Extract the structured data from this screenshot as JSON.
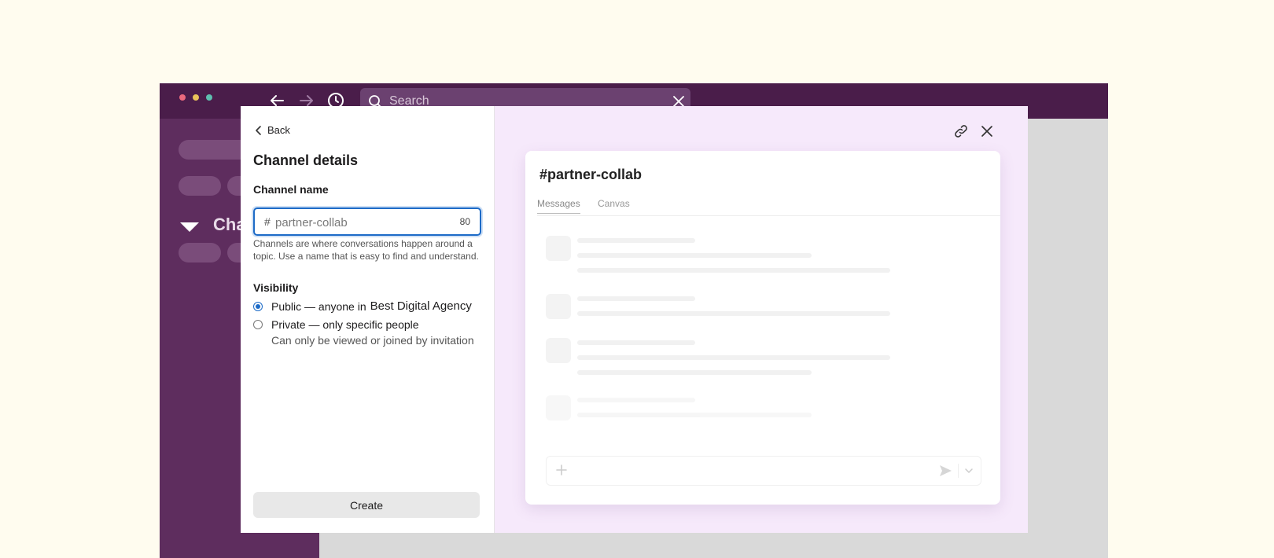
{
  "background_color": "#fffcef",
  "app": {
    "titlebar_color": "#4a1d4a",
    "sidebar_color": "#5e2d5e",
    "search": {
      "placeholder": "Search"
    },
    "sidebar": {
      "section_title": "Cha"
    }
  },
  "modal": {
    "back_label": "Back",
    "title": "Channel details",
    "channel_name": {
      "label": "Channel name",
      "prefix": "#",
      "value": "partner-collab",
      "char_count": "80",
      "help": "Channels are where conversations happen around a topic. Use a name that is easy to find and understand."
    },
    "visibility": {
      "label": "Visibility",
      "public_label": "Public — anyone in",
      "workspace": "Best Digital Agency",
      "private_label": "Private — only specific people",
      "private_sub": "Can only be viewed or joined by invitation",
      "selected": "public"
    },
    "create_label": "Create",
    "accent_color": "#1d6bc7"
  },
  "preview": {
    "channel_title": "#partner-collab",
    "tabs": [
      "Messages",
      "Canvas"
    ],
    "active_tab": "Messages",
    "pane_color": "#f6e9fb"
  },
  "icons": {
    "back": "chevron-left-icon",
    "forward": "arrow-right-icon",
    "history": "clock-icon",
    "search": "search-icon",
    "clear": "close-icon",
    "link": "link-icon",
    "close": "close-icon",
    "composer_add": "plus-icon",
    "send": "send-icon",
    "send_options": "chevron-down-icon"
  }
}
